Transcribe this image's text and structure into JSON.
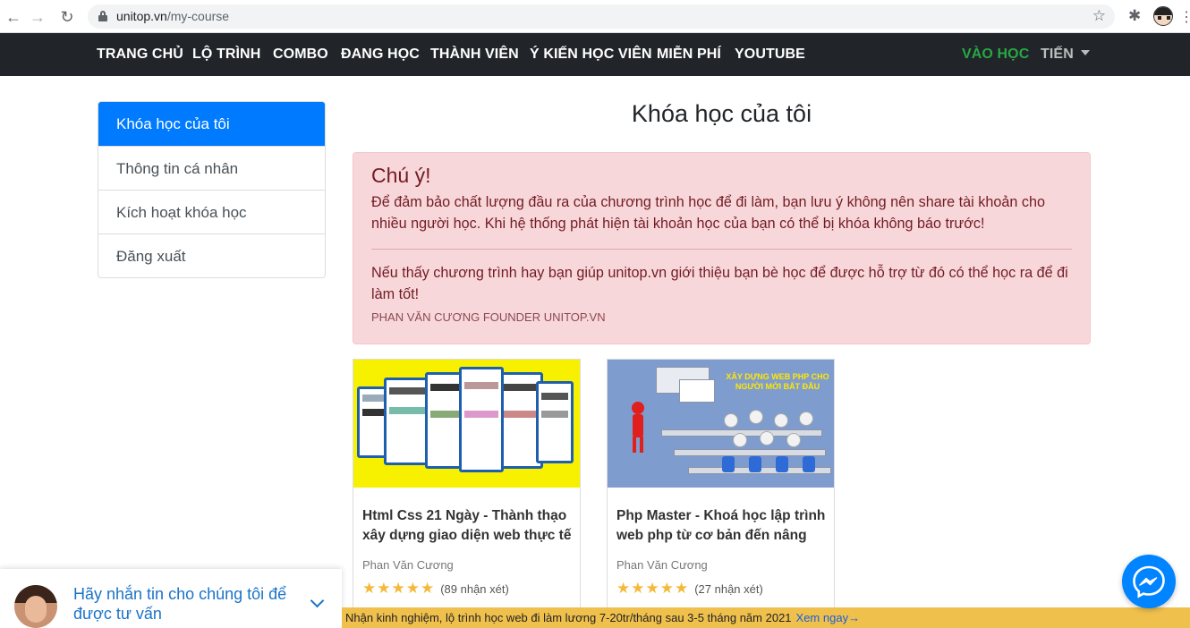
{
  "browser": {
    "url_host": "unitop.vn",
    "url_path": "/my-course"
  },
  "nav": {
    "items": [
      "TRANG CHỦ",
      "LỘ TRÌNH",
      "COMBO",
      "ĐANG HỌC",
      "THÀNH VIÊN",
      "Ý KIẾN HỌC VIÊN",
      "MIỄN PHÍ",
      "YOUTUBE"
    ],
    "login": "VÀO HỌC",
    "user": "TIẾN"
  },
  "sidebar": {
    "items": [
      "Khóa học của tôi",
      "Thông tin cá nhân",
      "Kích hoạt khóa học",
      "Đăng xuất"
    ]
  },
  "main": {
    "title": "Khóa học của tôi",
    "alert": {
      "heading": "Chú ý!",
      "p1": "Để đảm bảo chất lượng đầu ra của chương trình học để đi làm, bạn lưu ý không nên share tài khoản cho nhiều người học. Khi hệ thống phát hiện tài khoản học của bạn có thể bị khóa không báo trước!",
      "p2": "Nếu thấy chương trình hay bạn giúp unitop.vn giới thiệu bạn bè học để được hỗ trợ từ đó có thể học ra để đi làm tốt!",
      "signature": "PHAN VĂN CƯƠNG FOUNDER UNITOP.VN"
    },
    "courses": [
      {
        "title": "Html Css 21 Ngày - Thành thạo xây dựng giao diện web thực tế",
        "author": "Phan Văn Cương",
        "stars": "★★★★★",
        "reviews": "(89 nhận xét)"
      },
      {
        "title": "Php Master - Khoá học lập trình web php từ cơ bản đến nâng",
        "author": "Phan Văn Cương",
        "stars": "★★★★★",
        "reviews": "(27 nhận xét)",
        "thumb_banner": "XÂY DỰNG WEB PHP CHO NGƯỜI MỚI BẮT ĐẦU"
      }
    ]
  },
  "chat": {
    "text": "Hãy nhắn tin cho chúng tôi để được tư vấn"
  },
  "promo": {
    "text": "Nhận kinh nghiệm, lộ trình học web đi làm lương 7-20tr/tháng sau 3-5 tháng năm 2021",
    "link": "Xem ngay→"
  },
  "colors": {
    "nav_bg": "#212529",
    "active": "#007bff",
    "login": "#28a745",
    "alert_bg": "#f8d7da",
    "promo_bg": "#f0c04d",
    "messenger": "#0084ff"
  }
}
